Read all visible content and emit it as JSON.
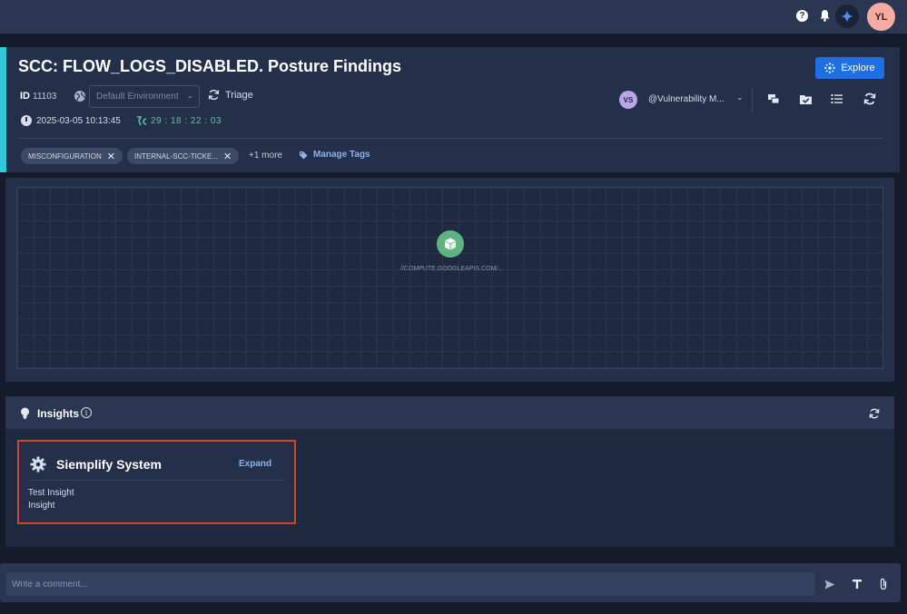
{
  "topbar": {
    "help_icon": "question-mark",
    "help_glyph": "?",
    "bell_icon": "bell",
    "ai_icon": "sparkle",
    "user_initials": "YL"
  },
  "case": {
    "title": "SCC: FLOW_LOGS_DISABLED. Posture Findings",
    "explore_label": "Explore",
    "id_label": "ID",
    "id_value": "11103",
    "environment": "Default Environment",
    "stage": "Triage",
    "created": "2025-03-05 10:13:45",
    "sla_timer": "29 : 18 : 22 : 03",
    "assignee_initials": "VS",
    "assignee_name": "@Vulnerability M...",
    "tags": [
      "MISCONFIGURATION",
      "INTERNAL-SCC-TICKE..."
    ],
    "more_tags": "+1 more",
    "manage_tags": "Manage Tags",
    "accent_color": "#35c7d9"
  },
  "graph": {
    "node_label": "//COMPUTE.GOOGLEAPIS.COM/...",
    "node_color": "#5fb380"
  },
  "insights": {
    "title": "Insights",
    "card": {
      "source": "Siemplify System",
      "expand_label": "Expand",
      "line1": "Test Insight",
      "line2": "Insight",
      "border_color": "#d2442f"
    }
  },
  "comment": {
    "placeholder": "Write a comment..."
  }
}
